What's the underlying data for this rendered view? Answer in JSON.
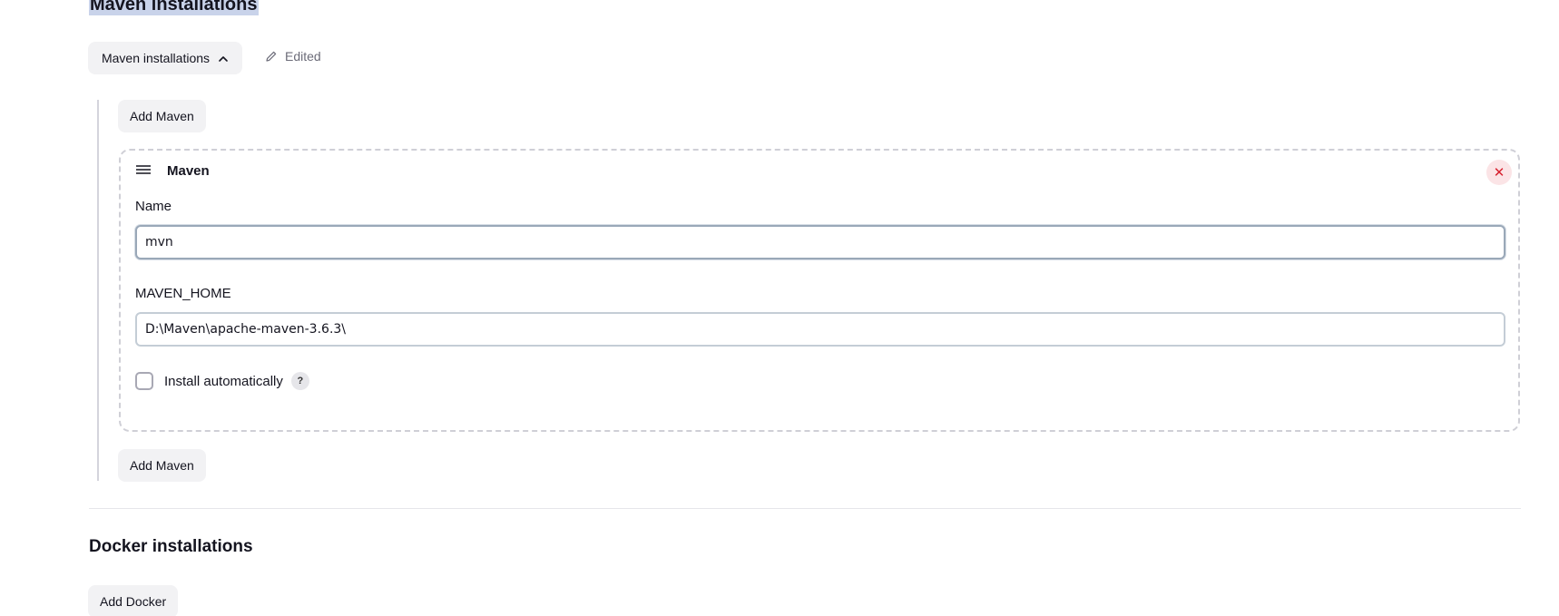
{
  "maven_section": {
    "title": "Maven installations",
    "collapse_button_label": "Maven installations",
    "edited_label": "Edited",
    "add_button_top": "Add Maven",
    "add_button_bottom": "Add Maven",
    "installation": {
      "header": "Maven",
      "close_symbol": "✕",
      "name_label": "Name",
      "name_value": "mvn",
      "home_label": "MAVEN_HOME",
      "home_value": "D:\\Maven\\apache-maven-3.6.3\\",
      "install_auto_label": "Install automatically",
      "install_auto_checked": false,
      "help_symbol": "?"
    }
  },
  "docker_section": {
    "title": "Docker installations",
    "add_button": "Add Docker"
  },
  "icons": {
    "collapse": "chevron-up-icon",
    "edited": "pencil-icon",
    "drag": "drag-handle-icon",
    "close": "close-icon",
    "help": "help-icon"
  },
  "colors": {
    "selection_highlight": "#c9d3ea",
    "close_red": "#d6212f",
    "button_bg": "#f2f2f4"
  }
}
